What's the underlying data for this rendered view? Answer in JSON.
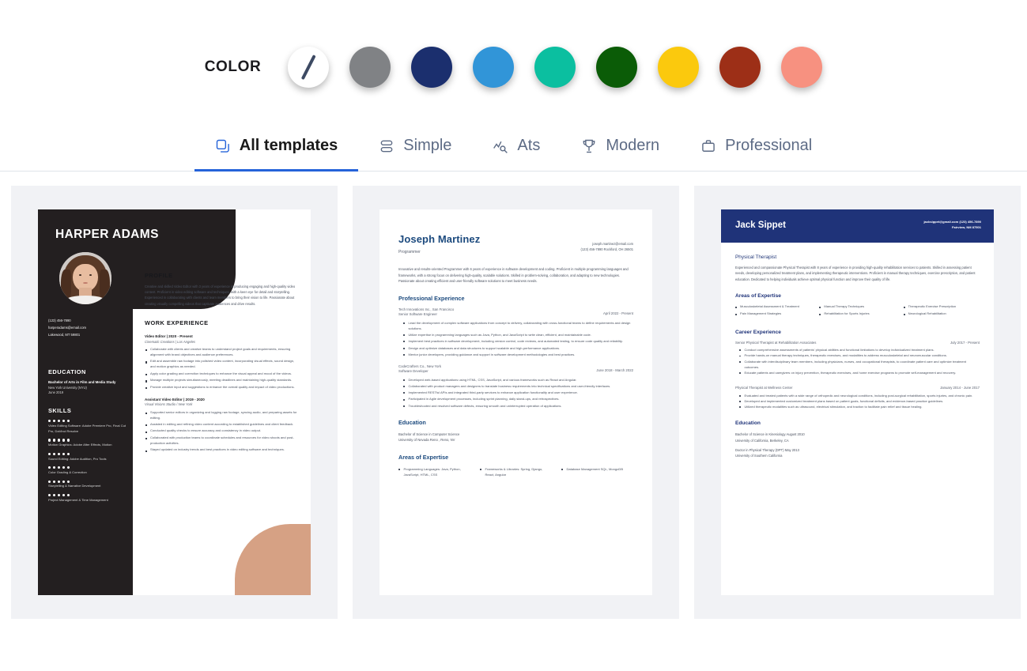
{
  "color_picker": {
    "label": "COLOR",
    "swatches": [
      {
        "name": "none",
        "hex": "#ffffff"
      },
      {
        "name": "gray",
        "hex": "#808285"
      },
      {
        "name": "navy",
        "hex": "#1b2f6e"
      },
      {
        "name": "blue",
        "hex": "#3195d8"
      },
      {
        "name": "teal",
        "hex": "#0bbfa0"
      },
      {
        "name": "green",
        "hex": "#0b5c07"
      },
      {
        "name": "yellow",
        "hex": "#fbc90d"
      },
      {
        "name": "brick",
        "hex": "#9d2f17"
      },
      {
        "name": "salmon",
        "hex": "#f79180"
      }
    ]
  },
  "tabs": [
    {
      "label": "All templates",
      "icon": "copy-icon",
      "active": true
    },
    {
      "label": "Simple",
      "icon": "stack-icon",
      "active": false
    },
    {
      "label": "Ats",
      "icon": "chart-search-icon",
      "active": false
    },
    {
      "label": "Modern",
      "icon": "trophy-icon",
      "active": false
    },
    {
      "label": "Professional",
      "icon": "briefcase-icon",
      "active": false
    }
  ],
  "templates": [
    {
      "id": "harper-adams",
      "name": "HARPER ADAMS",
      "contact": {
        "phone": "(123) 456-7890",
        "email": "harperadams@email.com",
        "location": "Lakewood, MT 59801"
      },
      "profile": {
        "heading": "PROFILE",
        "text": "Creative and skilled Video Editor with 3 years of experience in producing engaging and high-quality video content. Proficient in video editing software and techniques, with a keen eye for detail and storytelling. Experienced in collaborating with clients and team members to bring their vision to life. Passionate about creating visually compelling videos that captivate audiences and drive results."
      },
      "work": {
        "heading": "WORK EXPERIENCE",
        "jobs": [
          {
            "title": "Video Editor | 2020 - Present",
            "company": "Cinematic Creations | Los Angeles",
            "bullets": [
              "Collaborate with clients and creative teams to understand project goals and requirements, ensuring alignment with brand objectives and audience preferences.",
              "Edit and assemble raw footage into polished video content, incorporating visual effects, sound design, and motion graphics as needed.",
              "Apply color grading and correction techniques to enhance the visual appeal and mood of the videos.",
              "Manage multiple projects simultaneously, meeting deadlines and maintaining high-quality standards.",
              "Provide creative input and suggestions to enhance the overall quality and impact of video productions."
            ]
          },
          {
            "title": "Assistant Video Editor | 2019 - 2020",
            "company": "Visual Visions Studio / New York",
            "bullets": [
              "Supported senior editors in organizing and logging raw footage, syncing audio, and preparing assets for editing.",
              "Assisted in editing and refining video content according to established guidelines and client feedback.",
              "Conducted quality checks to ensure accuracy and consistency in video output.",
              "Collaborated with production teams to coordinate schedules and resources for video shoots and post-production activities.",
              "Stayed updated on industry trends and best practices in video editing software and techniques."
            ]
          }
        ]
      },
      "education": {
        "heading": "EDUCATION",
        "degree": "Bachelor of Arts in Film and Media Study",
        "school": "New York University (NYU)",
        "date": "June 2019"
      },
      "skills": {
        "heading": "SKILLS",
        "items": [
          "Video Editing Software: Adobe Premiere Pro, Final Cut Pro, DaVinci Resolve",
          "Motion Graphics: Adobe After Effects, Motion",
          "Sound Editing: Adobe Audition, Pro Tools",
          "Color Grading & Correction",
          "Storytelling & Narrative Development",
          "Project Management & Time Management"
        ]
      }
    },
    {
      "id": "joseph-martinez",
      "name": "Joseph Martinez",
      "role": "Programmer",
      "contact": {
        "email": "joseph.martinez@email.com",
        "phone_location": "(123) 456-7890   Rockford, OH 26501"
      },
      "summary": "Innovative and results-oriented Programmer with 6 years of experience in software development and coding. Proficient in multiple programming languages and frameworks, with a strong focus on delivering high-quality, scalable solutions. Skilled in problem-solving, collaboration, and adapting to new technologies. Passionate about creating efficient and user-friendly software solutions to meet business needs.",
      "experience": {
        "heading": "Professional Experience",
        "jobs": [
          {
            "org": "Tech Innovations Inc., San Francisco",
            "position": "Senior Software Engineer",
            "date": "April 2022 - Present",
            "bullets": [
              "Lead the development of complex software applications from concept to delivery, collaborating with cross-functional teams to define requirements and design solutions.",
              "Utilize expertise in programming languages such as Java, Python, and JavaScript to write clean, efficient, and maintainable code.",
              "Implement best practices in software development, including version control, code reviews, and automated testing, to ensure code quality and reliability.",
              "Design and optimize databases and data structures to support scalable and high-performance applications.",
              "Mentor junior developers, providing guidance and support in software development methodologies and best practices."
            ]
          },
          {
            "org": "CodeCrafters Co., New York",
            "position": "Software Developer",
            "date": "June 2018 - March 2022",
            "bullets": [
              "Developed web-based applications using HTML, CSS, JavaScript, and various frameworks such as React and Angular.",
              "Collaborated with product managers and designers to translate business requirements into technical specifications and user-friendly interfaces.",
              "Implemented RESTful APIs and integrated third-party services to enhance application functionality and user experience.",
              "Participated in Agile development processes, including sprint planning, daily stand-ups, and retrospectives.",
              "Troubleshooted and resolved software defects, ensuring smooth and uninterrupted operation of applications."
            ]
          }
        ]
      },
      "education": {
        "heading": "Education",
        "degree": "Bachelor of Science in Computer Science",
        "school": "University of Nevada Reno , Reno, NV"
      },
      "expertise": {
        "heading": "Areas of Expertise",
        "items": [
          "Programming Languages: Java, Python, JavaScript, HTML, CSS",
          "Frameworks & Libraries: Spring, Django, React, Angular",
          "Database Management SQL, MongoDB"
        ]
      }
    },
    {
      "id": "jack-sippet",
      "name": "Jack Sippet",
      "contact": {
        "line1": "jacksippet@gmail.com   (123) 456-7890",
        "line2": "Fairview, NM 87501"
      },
      "role": "Physical Therapist",
      "summary": "Experienced and compassionate Physical Therapist with 8 years of experience in providing high-quality rehabilitation services to patients. Skilled in assessing patient needs, developing personalized treatment plans, and implementing therapeutic interventions. Proficient in manual therapy techniques, exercise prescription, and patient education. Dedicated to helping individuals achieve optimal physical function and improve their quality of life.",
      "expertise": {
        "heading": "Areas of Expertise",
        "items": [
          "Musculoskeletal Assessment & Treatment",
          "Manual Therapy Techniques",
          "Therapeutic Exercise Prescription",
          "Pain Management Strategies",
          "Rehabilitation for Sports Injuries",
          "Neurological Rehabilitation"
        ]
      },
      "career": {
        "heading": "Career Experience",
        "jobs": [
          {
            "org": "Senior Physical Therapist at Rehabilitation Associates",
            "date": "July 2017 - Present",
            "bullets": [
              "Conduct comprehensive assessments of patients' physical abilities and functional limitations to develop individualized treatment plans.",
              "Provide hands-on manual therapy techniques, therapeutic exercises, and modalities to address musculoskeletal and neuromuscular conditions.",
              "Collaborate with interdisciplinary team members, including physicians, nurses, and occupational therapists, to coordinate patient care and optimize treatment outcomes.",
              "Educate patients and caregivers on injury prevention, therapeutic exercises, and home exercise programs to promote self-management and recovery."
            ]
          },
          {
            "org": "Physical Therapist at Wellness Center",
            "date": "January 2014 - June 2017",
            "bullets": [
              "Evaluated and treated patients with a wide range of orthopedic and neurological conditions, including post-surgical rehabilitation, sports injuries, and chronic pain.",
              "Developed and implemented customized treatment plans based on patient goals, functional deficits, and evidence-based practice guidelines.",
              "Utilized therapeutic modalities such as ultrasound, electrical stimulation, and traction to facilitate pain relief and tissue healing."
            ]
          }
        ]
      },
      "education": {
        "heading": "Education",
        "entries": [
          {
            "degree": "Bachelor of Science in Kinesiology August 2010",
            "school": "University of California, Berkeley, CA"
          },
          {
            "degree": "Doctor in Physical Therapy (DPT) May 2013",
            "school": "University of Southern California"
          }
        ]
      }
    }
  ]
}
